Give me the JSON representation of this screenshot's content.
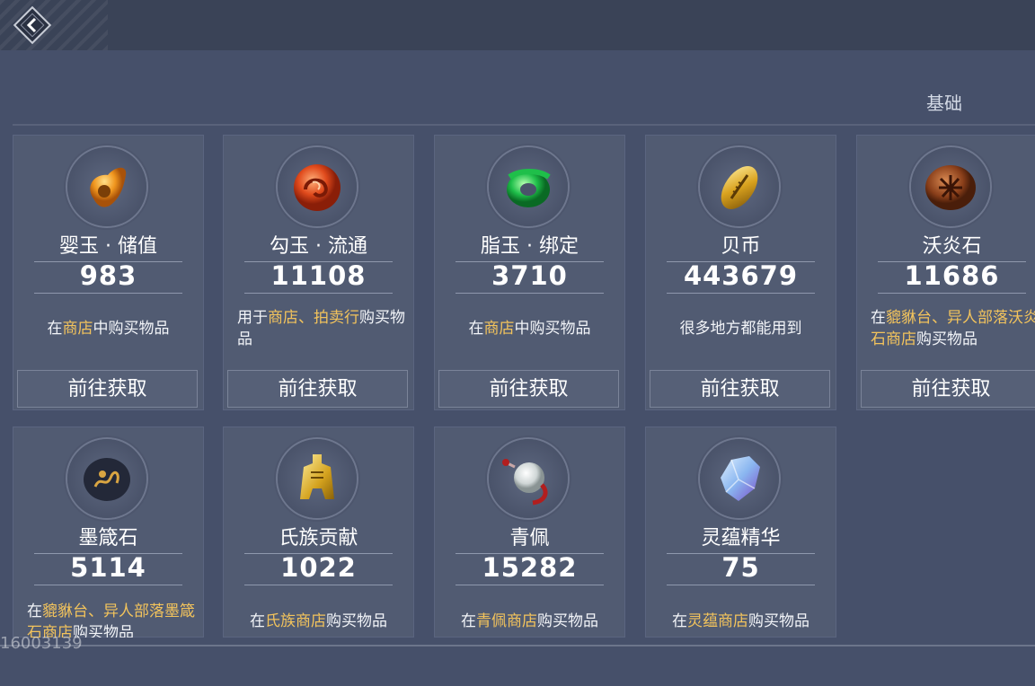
{
  "header": {
    "back_icon": "back-arrow-icon"
  },
  "tabs": [
    {
      "label": "基础"
    }
  ],
  "currencies": [
    {
      "name": "婴玉 · 储值",
      "count": "983",
      "desc": [
        {
          "t": "在"
        },
        {
          "t": "商店",
          "hl": true
        },
        {
          "t": "中购买物品"
        }
      ],
      "center": true,
      "button": "前往获取",
      "icon": "jade-amber-icon"
    },
    {
      "name": "勾玉 · 流通",
      "count": "11108",
      "desc": [
        {
          "t": "用于"
        },
        {
          "t": "商店、拍卖行",
          "hl": true
        },
        {
          "t": "购买物品"
        }
      ],
      "center": false,
      "button": "前往获取",
      "icon": "magatama-red-icon"
    },
    {
      "name": "脂玉 · 绑定",
      "count": "3710",
      "desc": [
        {
          "t": "在"
        },
        {
          "t": "商店",
          "hl": true
        },
        {
          "t": "中购买物品"
        }
      ],
      "center": true,
      "button": "前往获取",
      "icon": "jade-green-icon"
    },
    {
      "name": "贝币",
      "count": "443679",
      "desc": [
        {
          "t": "很多地方都能用到"
        }
      ],
      "center": true,
      "button": "前往获取",
      "icon": "shell-coin-icon"
    },
    {
      "name": "沃炎石",
      "count": "11686",
      "desc": [
        {
          "t": "在"
        },
        {
          "t": "貔貅台、异人部落沃炎石商店",
          "hl": true
        },
        {
          "t": "购买物品"
        }
      ],
      "center": false,
      "button": "前往获取",
      "icon": "flame-stone-icon"
    },
    {
      "name": "墨箴石",
      "count": "5114",
      "desc": [
        {
          "t": "在"
        },
        {
          "t": "貔貅台、异人部落墨箴石商店",
          "hl": true
        },
        {
          "t": "购买物品"
        }
      ],
      "center": false,
      "button": "",
      "icon": "ink-stone-icon"
    },
    {
      "name": "氏族贡献",
      "count": "1022",
      "desc": [
        {
          "t": "在"
        },
        {
          "t": "氏族商店",
          "hl": true
        },
        {
          "t": "购买物品"
        }
      ],
      "center": true,
      "button": "",
      "icon": "clan-token-icon"
    },
    {
      "name": "青佩",
      "count": "15282",
      "desc": [
        {
          "t": "在"
        },
        {
          "t": "青佩商店",
          "hl": true
        },
        {
          "t": "购买物品"
        }
      ],
      "center": true,
      "button": "",
      "icon": "jade-pendant-icon"
    },
    {
      "name": "灵蕴精华",
      "count": "75",
      "desc": [
        {
          "t": "在"
        },
        {
          "t": "灵蕴商店",
          "hl": true
        },
        {
          "t": "购买物品"
        }
      ],
      "center": true,
      "button": "",
      "icon": "spirit-essence-icon"
    }
  ],
  "footer": {
    "uid": "16003139"
  },
  "colors": {
    "highlight": "#f2c35c",
    "card": "#515b72",
    "background": "#46506a"
  }
}
